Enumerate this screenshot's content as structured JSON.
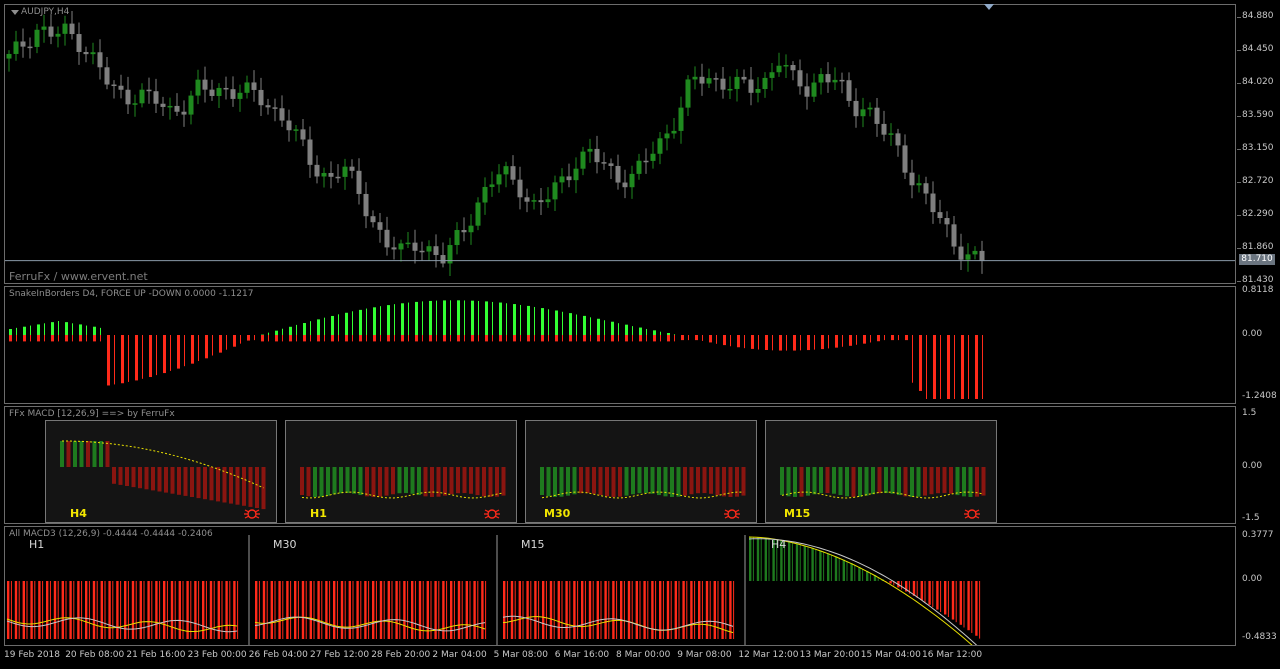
{
  "window": {
    "title": "AUDJPY,H4",
    "watermark": "FerruFx / www.ervent.net"
  },
  "colors": {
    "bull": "#1f8a1f",
    "bear": "#7f7f7f",
    "up_histo": "#33ff33",
    "down_histo": "#ff2a1a",
    "signal": "#e8e000",
    "macd_line": "#c8c8c8",
    "grid": "#6c6c6c"
  },
  "price_axis": {
    "ticks": [
      "84.880",
      "84.450",
      "84.020",
      "83.590",
      "83.150",
      "82.720",
      "82.290",
      "81.860",
      "81.430"
    ],
    "current_price": "81.710"
  },
  "indicators": {
    "snake": {
      "label": "SnakeInBorders D4, FORCE UP -DOWN  0.0000 -1.1217",
      "ticks": [
        "0.8118",
        "0.00",
        "-1.2408"
      ]
    },
    "ffx_macd": {
      "label": "FFx MACD [12,26,9] ==> by FerruFx",
      "ticks": [
        "1.5",
        "0.00",
        "-1.5"
      ],
      "panels": [
        {
          "tf": "H4",
          "icon": "bug-icon"
        },
        {
          "tf": "H1",
          "icon": "bug-icon"
        },
        {
          "tf": "M30",
          "icon": "bug-icon"
        },
        {
          "tf": "M15",
          "icon": "bug-icon"
        }
      ]
    },
    "all_macd": {
      "label": "All MACD3 (12,26,9) -0.4444 -0.4444 -0.2406",
      "ticks": [
        "0.3777",
        "0.00",
        "-0.4833"
      ],
      "sections": [
        "H1",
        "M30",
        "M15",
        "H4"
      ]
    }
  },
  "time_axis": [
    "19 Feb 2018",
    "20 Feb 08:00",
    "21 Feb 16:00",
    "23 Feb 00:00",
    "26 Feb 04:00",
    "27 Feb 12:00",
    "28 Feb 20:00",
    "2 Mar 04:00",
    "5 Mar 08:00",
    "6 Mar 16:00",
    "8 Mar 00:00",
    "9 Mar 08:00",
    "12 Mar 12:00",
    "13 Mar 20:00",
    "15 Mar 04:00",
    "16 Mar 12:00"
  ],
  "chart_data": {
    "type": "candlestick",
    "symbol": "AUDJPY",
    "timeframe": "H4",
    "ylim": [
      81.43,
      84.88
    ],
    "close_path": [
      84.35,
      84.55,
      84.75,
      84.65,
      84.7,
      84.55,
      84.3,
      83.95,
      83.85,
      83.9,
      83.8,
      83.65,
      83.75,
      83.95,
      83.9,
      83.95,
      83.95,
      83.85,
      83.7,
      83.6,
      83.25,
      82.9,
      82.8,
      82.95,
      82.6,
      82.25,
      81.95,
      81.8,
      81.95,
      81.85,
      81.7,
      82.05,
      82.35,
      82.7,
      82.85,
      82.75,
      82.4,
      82.5,
      82.75,
      83.0,
      83.1,
      82.95,
      82.8,
      82.8,
      83.05,
      83.3,
      83.6,
      84.05,
      84.1,
      84.05,
      84.0,
      83.95,
      84.05,
      84.35,
      84.05,
      83.95,
      84.15,
      84.05,
      83.7,
      83.75,
      83.45,
      83.2,
      82.85,
      82.6,
      82.25,
      81.95,
      81.8,
      81.71
    ]
  }
}
